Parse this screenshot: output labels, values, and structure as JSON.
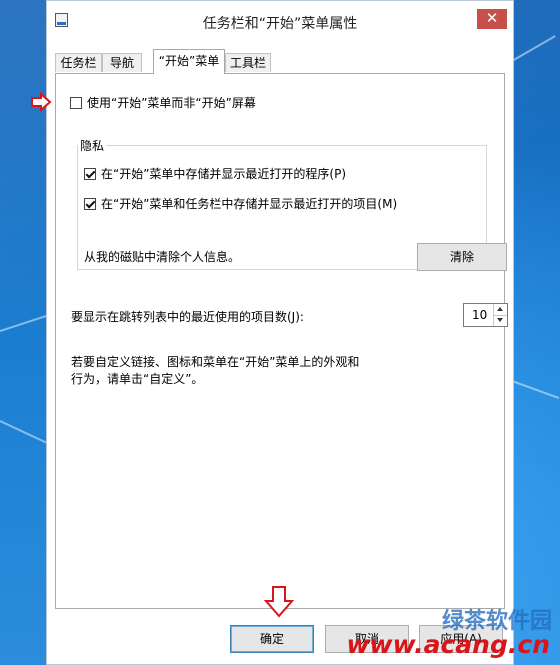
{
  "window": {
    "title": "任务栏和“开始”菜单属性",
    "close_glyph": "✕"
  },
  "tabs": [
    {
      "label": "任务栏"
    },
    {
      "label": "导航"
    },
    {
      "label": "“开始”菜单",
      "active": true
    },
    {
      "label": "工具栏"
    }
  ],
  "start_menu": {
    "use_start_menu_label": "使用“开始”菜单而非“开始”屏幕",
    "use_start_menu_checked": false,
    "privacy": {
      "label": "隐私",
      "store_programs_label": "在“开始”菜单中存储并显示最近打开的程序(P)",
      "store_programs_checked": true,
      "store_items_label": "在“开始”菜单和任务栏中存储并显示最近打开的项目(M)",
      "store_items_checked": true,
      "clear_info_text": "从我的磁贴中清除个人信息。",
      "clear_button": "清除"
    },
    "jumplist_label": "要显示在跳转列表中的最近使用的项目数(J):",
    "jumplist_count": "10",
    "customize_text_line1": "若要自定义链接、图标和菜单在“开始”菜单上的外观和",
    "customize_text_line2": "行为，请单击“自定义”。"
  },
  "buttons": {
    "ok": "确定",
    "cancel": "取消",
    "apply": "应用(A)"
  },
  "watermark": {
    "brand": "绿茶软件园",
    "site": "www.acang.cn"
  },
  "colors": {
    "close_red": "#c7514a",
    "arrow_red": "#d8151b",
    "desktop_blue": "#1b78c8"
  }
}
